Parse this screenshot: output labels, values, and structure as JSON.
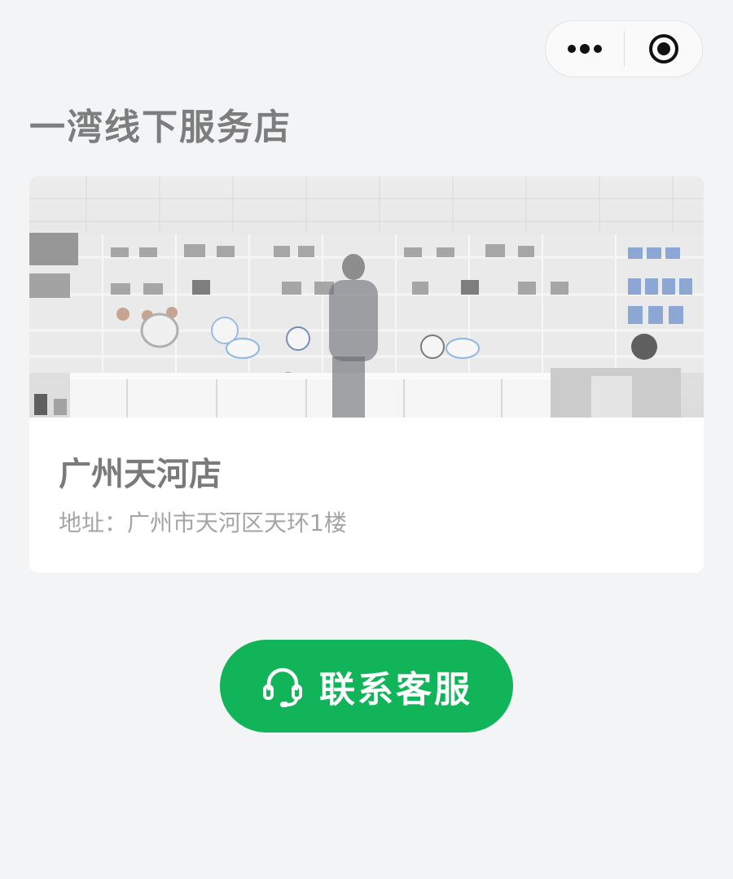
{
  "capsule": {
    "more_icon": "ellipsis-icon",
    "close_icon": "target-circle-icon"
  },
  "page": {
    "title": "一湾线下服务店"
  },
  "store_card": {
    "photo_alt": "",
    "name": "广州天河店",
    "address": "地址：广州市天河区天环1楼"
  },
  "contact_button": {
    "label": "联系客服",
    "icon": "headset-icon",
    "color": "#12b45a"
  }
}
